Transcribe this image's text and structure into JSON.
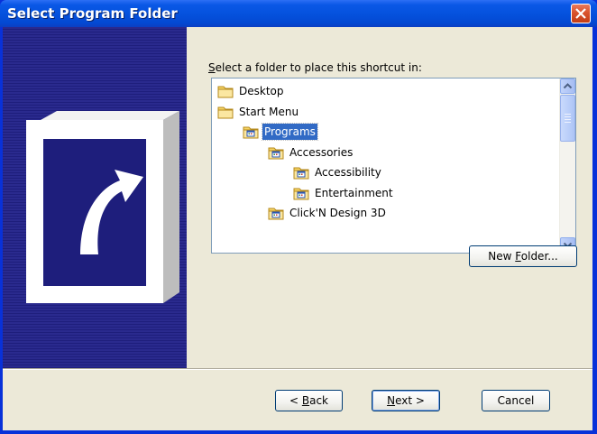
{
  "window": {
    "title": "Select Program Folder",
    "close_label": "×"
  },
  "prompt": {
    "before": "",
    "accel": "S",
    "after": "elect a folder to place this shortcut in:"
  },
  "tree": {
    "items": [
      {
        "label": "Desktop",
        "level": 0,
        "icon": "folder-icon",
        "selected": false
      },
      {
        "label": "Start Menu",
        "level": 0,
        "icon": "folder-icon",
        "selected": false
      },
      {
        "label": "Programs",
        "level": 1,
        "icon": "program-folder-icon",
        "selected": true
      },
      {
        "label": "Accessories",
        "level": 2,
        "icon": "program-folder-icon",
        "selected": false
      },
      {
        "label": "Accessibility",
        "level": 3,
        "icon": "program-folder-icon",
        "selected": false
      },
      {
        "label": "Entertainment",
        "level": 3,
        "icon": "program-folder-icon",
        "selected": false
      },
      {
        "label": "Click'N Design 3D",
        "level": 2,
        "icon": "program-folder-icon",
        "selected": false
      }
    ]
  },
  "buttons": {
    "new_folder": {
      "before": "New ",
      "accel": "F",
      "after": "older..."
    },
    "back": {
      "before": "< ",
      "accel": "B",
      "after": "ack"
    },
    "next": {
      "before": "",
      "accel": "N",
      "after": "ext >"
    },
    "cancel": "Cancel"
  },
  "colors": {
    "titlebar": "#0552de",
    "banner": "#2a2a8e",
    "selection": "#316ac5",
    "dialog_bg": "#ece9d8"
  }
}
